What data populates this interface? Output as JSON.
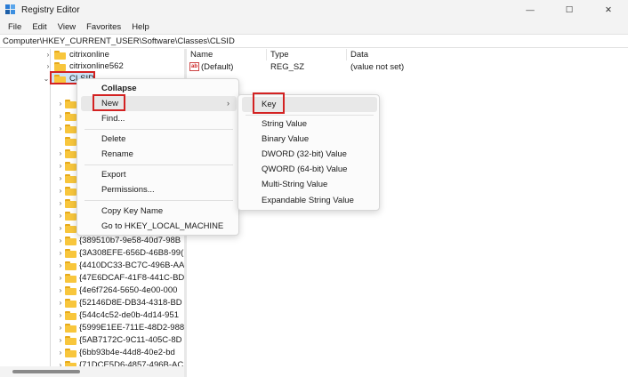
{
  "window": {
    "title": "Registry Editor",
    "controls": {
      "minimize": "—",
      "maximize": "☐",
      "close": "✕"
    }
  },
  "menubar": [
    "File",
    "Edit",
    "View",
    "Favorites",
    "Help"
  ],
  "address": "Computer\\HKEY_CURRENT_USER\\Software\\Classes\\CLSID",
  "tree": {
    "items_above": [
      {
        "label": "citrixonline"
      },
      {
        "label": "citrixonline562"
      }
    ],
    "selected": "CLSID",
    "guid_items": [
      "{389510b7-9e58-40d7-98B",
      "{3A308EFE-656D-46B8-99(",
      "{4410DC33-BC7C-496B-AA",
      "{47E6DCAF-41F8-441C-BD",
      "{4e6f7264-5650-4e00-000",
      "{52146D8E-DB34-4318-BD",
      "{544c4c52-de0b-4d14-951",
      "{5999E1EE-711E-48D2-988",
      "{5AB7172C-9C11-405C-8D",
      "{6bb93b4e-44d8-40e2-bd",
      "{71DCE5D6-4857-496B-AC"
    ]
  },
  "list": {
    "columns": [
      "Name",
      "Type",
      "Data"
    ],
    "rows": [
      {
        "name": "(Default)",
        "type": "REG_SZ",
        "data": "(value not set)",
        "icon_text": "ab"
      }
    ]
  },
  "context_menu": {
    "collapse": "Collapse",
    "new": "New",
    "new_arrow": "›",
    "find": "Find...",
    "delete": "Delete",
    "rename": "Rename",
    "export": "Export",
    "permissions": "Permissions...",
    "copy_key_name": "Copy Key Name",
    "goto": "Go to HKEY_LOCAL_MACHINE"
  },
  "new_submenu": {
    "key": "Key",
    "string": "String Value",
    "binary": "Binary Value",
    "dword": "DWORD (32-bit) Value",
    "qword": "QWORD (64-bit) Value",
    "multi": "Multi-String Value",
    "expandable": "Expandable String Value"
  },
  "colors": {
    "highlight": "#d32222",
    "selection": "#cde4f7",
    "folder": "#f8c63c"
  }
}
